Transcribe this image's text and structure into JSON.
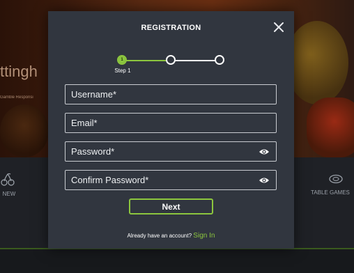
{
  "background": {
    "hero_title": "ttingh",
    "hero_subtitle": "Gamble Responsi",
    "nav_left_label": "NEW",
    "nav_right_label": "TABLE GAMES"
  },
  "modal": {
    "title": "REGISTRATION",
    "close_icon": "close-icon",
    "stepper": {
      "current_step_number": "1",
      "current_step_label": "Step 1",
      "total_steps": 3
    },
    "fields": {
      "username_placeholder": "Username*",
      "email_placeholder": "Email*",
      "password_placeholder": "Password*",
      "confirm_password_placeholder": "Confirm Password*"
    },
    "next_label": "Next",
    "signin_prompt": "Already have an account?",
    "signin_link": "Sign In"
  },
  "colors": {
    "accent": "#8cc63e",
    "modal_bg": "#31363f"
  }
}
